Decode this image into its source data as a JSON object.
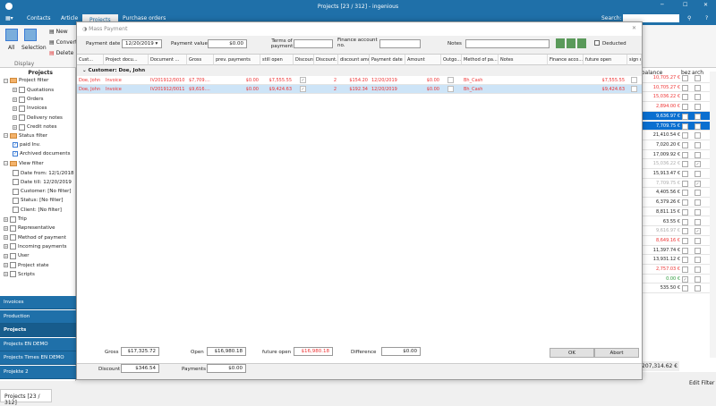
{
  "window": {
    "title": "Projects [23 / 312] - ingenious",
    "search_label": "Search:"
  },
  "tabs": [
    "Contacts",
    "Article",
    "Projects",
    "Purchase orders"
  ],
  "ribbon": {
    "all": "All",
    "selection": "Selection",
    "display": "Display",
    "new": "New",
    "convert": "Convert",
    "delete": "Delete"
  },
  "sidebar": {
    "header": "Projects",
    "tree": [
      {
        "label": "Project filter",
        "level": 0
      },
      {
        "label": "Quotations",
        "level": 1
      },
      {
        "label": "Orders",
        "level": 1
      },
      {
        "label": "Invoices",
        "level": 1
      },
      {
        "label": "Delivery notes",
        "level": 1
      },
      {
        "label": "Credit notes",
        "level": 1
      },
      {
        "label": "Status filter",
        "level": 0
      },
      {
        "label": "paid Inv.",
        "level": 1
      },
      {
        "label": "Archived documents",
        "level": 1
      },
      {
        "label": "View filter",
        "level": 0
      },
      {
        "label": "Date from: 12/1/2018",
        "level": 1
      },
      {
        "label": "Date till: 12/20/2019",
        "level": 1
      },
      {
        "label": "Customer: [No filter]",
        "level": 1
      },
      {
        "label": "Status: [No filter]",
        "level": 1
      },
      {
        "label": "Client: [No filter]",
        "level": 1
      },
      {
        "label": "Trip",
        "level": 0
      },
      {
        "label": "Representative",
        "level": 0
      },
      {
        "label": "Method of payment",
        "level": 0
      },
      {
        "label": "Incoming payments",
        "level": 0
      },
      {
        "label": "User",
        "level": 0
      },
      {
        "label": "Project state",
        "level": 0
      },
      {
        "label": "Scripts",
        "level": 0
      }
    ],
    "nav": [
      "Invoices",
      "Production",
      "Projects",
      "Projects EN DEMO",
      "Projects Times EN DEMO",
      "Projekte 2"
    ],
    "selected_nav": "Projects"
  },
  "status_tab": "Projects [23 / 312]",
  "right_grid": {
    "headers": [
      "n balance",
      "bez",
      "arch"
    ],
    "rows": [
      {
        "v": "10,705.27 €",
        "c": "red",
        "bez": false,
        "arch": false
      },
      {
        "v": "10,705.27 €",
        "c": "red",
        "bez": false,
        "arch": false
      },
      {
        "v": "15,036.22 €",
        "c": "red",
        "bez": false,
        "arch": false
      },
      {
        "v": "2,894.00 €",
        "c": "red",
        "bez": false,
        "arch": false
      },
      {
        "v": "9,636.97 €",
        "c": "sel",
        "bez": false,
        "arch": false
      },
      {
        "v": "7,709.75 €",
        "c": "sel",
        "bez": false,
        "arch": false
      },
      {
        "v": "21,410.54 €",
        "c": "",
        "bez": false,
        "arch": false
      },
      {
        "v": "7,020.20 €",
        "c": "",
        "bez": false,
        "arch": false
      },
      {
        "v": "17,009.92 €",
        "c": "",
        "bez": false,
        "arch": false
      },
      {
        "v": "15,036.22 €",
        "c": "grey",
        "bez": false,
        "arch": true
      },
      {
        "v": "15,913.47 €",
        "c": "",
        "bez": false,
        "arch": false
      },
      {
        "v": "7,709.75 €",
        "c": "grey",
        "bez": false,
        "arch": true
      },
      {
        "v": "4,405.56 €",
        "c": "",
        "bez": false,
        "arch": false
      },
      {
        "v": "6,379.26 €",
        "c": "",
        "bez": false,
        "arch": false
      },
      {
        "v": "8,811.15 €",
        "c": "",
        "bez": false,
        "arch": false
      },
      {
        "v": "63.55 €",
        "c": "",
        "bez": false,
        "arch": false
      },
      {
        "v": "9,616.97 €",
        "c": "grey",
        "bez": false,
        "arch": true
      },
      {
        "v": "8,649.16 €",
        "c": "red",
        "bez": false,
        "arch": false
      },
      {
        "v": "11,397.74 €",
        "c": "",
        "bez": false,
        "arch": false
      },
      {
        "v": "13,931.12 €",
        "c": "",
        "bez": false,
        "arch": false
      },
      {
        "v": "2,757.03 €",
        "c": "red",
        "bez": false,
        "arch": false
      },
      {
        "v": "0.00 €",
        "c": "green",
        "bez": true,
        "arch": false
      },
      {
        "v": "535.50 €",
        "c": "",
        "bez": false,
        "arch": false
      }
    ],
    "total": "207,314.62 €",
    "edit_filter": "Edit Filter"
  },
  "dialog": {
    "title": "Mass Payment",
    "payment_date_label": "Payment date",
    "payment_date": "12/20/2019",
    "payment_value_label": "Payment value",
    "payment_value": "$0.00",
    "terms_label": "Terms of payment",
    "finance_label": "Finance account no.",
    "notes_label": "Notes",
    "deducted_label": "Deducted",
    "columns": [
      "Cust...",
      "Project docu...",
      "Document ...",
      "Gross",
      "prev. payments",
      "still open",
      "Discount",
      "Discount...",
      "discount amo...",
      "Payment date",
      "Amount",
      "Outgo...",
      "Method of pa...",
      "Notes",
      "Finance acco...",
      "future open",
      "sign out"
    ],
    "group": "Customer: Doe, John",
    "rows": [
      {
        "cust": "Doe, John",
        "type": "Invoice",
        "doc": "IV201912/0010",
        "gross": "$7,709....",
        "prev": "$0.00",
        "open": "$7,555.55",
        "disc": "2",
        "disc_amt": "$154.20",
        "date": "12/20/2019",
        "amount": "$0.00",
        "method": "Bh_Cash",
        "future": "$7,555.55"
      },
      {
        "cust": "Doe, John",
        "type": "Invoice",
        "doc": "IV201912/0011",
        "gross": "$9,616....",
        "prev": "$0.00",
        "open": "$9,424.63",
        "disc": "2",
        "disc_amt": "$192.34",
        "date": "12/20/2019",
        "amount": "$0.00",
        "method": "Bh_Cash",
        "future": "$9,424.63"
      }
    ],
    "footer": {
      "gross_label": "Gross",
      "gross": "$17,325.72",
      "open_label": "Open",
      "open": "$16,980.18",
      "future_label": "future open",
      "future": "$16,980.18",
      "diff_label": "Difference",
      "diff": "$0.00",
      "discount_label": "Discount",
      "discount": "$346.54",
      "payments_label": "Payments",
      "payments": "$0.00"
    },
    "ok": "OK",
    "abort": "Abort"
  }
}
